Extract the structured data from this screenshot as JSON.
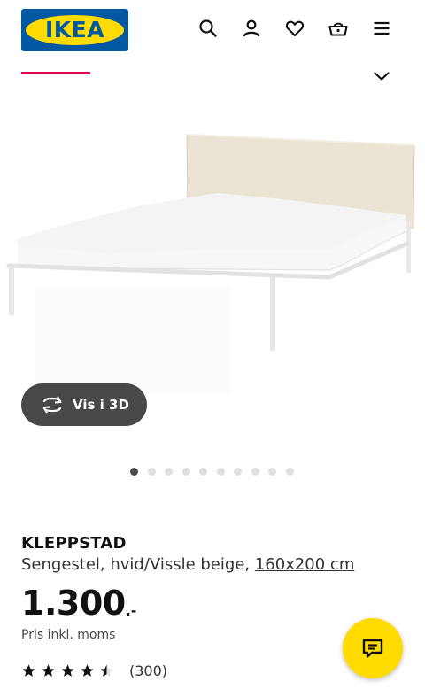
{
  "header": {
    "logo_text": "IKEA",
    "icons": [
      "search-icon",
      "user-icon",
      "heart-icon",
      "basket-icon",
      "menu-icon"
    ]
  },
  "colors": {
    "ikea_blue": "#0058a3",
    "ikea_yellow": "#ffdb00",
    "tab_underline": "#e00751",
    "dark_button": "#484848"
  },
  "gallery": {
    "vis3d_label": "Vis i 3D",
    "image_count": 10,
    "active_index": 0
  },
  "product": {
    "name": "KLEPPSTAD",
    "description": "Sengestel, hvid/Vissle beige, ",
    "size_link": "160x200 cm",
    "price": "1.300",
    "price_suffix": ".-",
    "price_note": "Pris inkl. moms",
    "rating": 4.5,
    "review_count": "(300)"
  }
}
